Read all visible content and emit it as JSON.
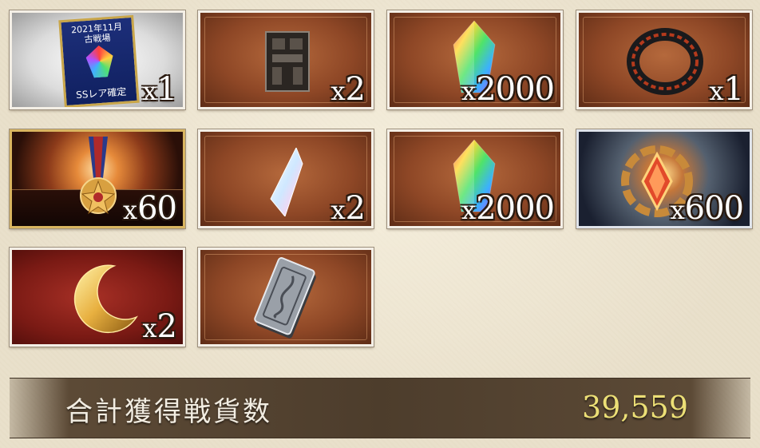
{
  "rewards": [
    {
      "name": "ticket",
      "count_prefix": "x",
      "count": "1",
      "ticket_line1": "2021年11月",
      "ticket_line2": "古戦場",
      "ticket_line3": "SSレア確定"
    },
    {
      "name": "stone-relic",
      "count_prefix": "x",
      "count": "2"
    },
    {
      "name": "rainbow-crystal",
      "count_prefix": "x",
      "count": "2000"
    },
    {
      "name": "black-ring",
      "count_prefix": "x",
      "count": "1"
    },
    {
      "name": "medal",
      "count_prefix": "x",
      "count": "60"
    },
    {
      "name": "white-crystal",
      "count_prefix": "x",
      "count": "2"
    },
    {
      "name": "rainbow-crystal",
      "count_prefix": "x",
      "count": "2000"
    },
    {
      "name": "golden-ornament",
      "count_prefix": "x",
      "count": "600"
    },
    {
      "name": "crescent-moon",
      "count_prefix": "x",
      "count": "2"
    },
    {
      "name": "silver-tablet",
      "count_prefix": "",
      "count": ""
    }
  ],
  "footer": {
    "label": "合計獲得戦貨数",
    "value": "39,559"
  }
}
